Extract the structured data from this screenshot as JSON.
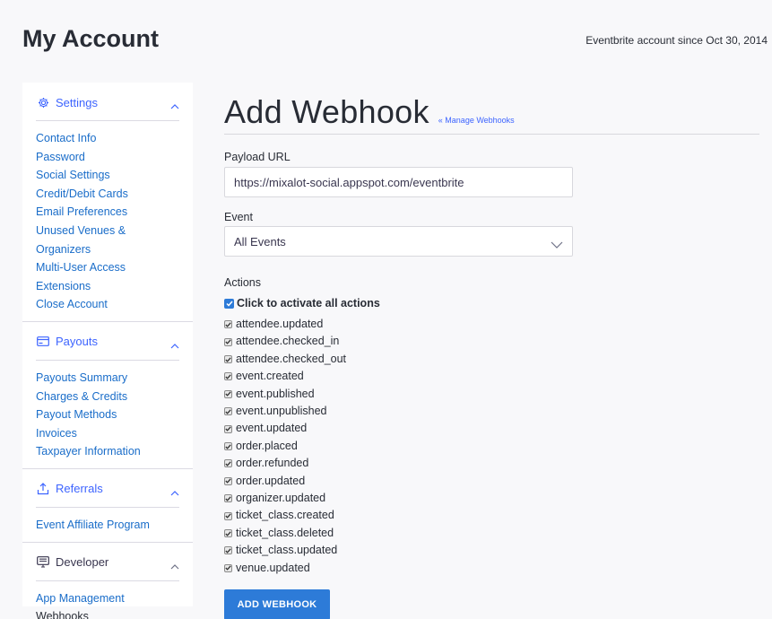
{
  "header": {
    "title": "My Account",
    "account_since": "Eventbrite account since Oct 30, 2014"
  },
  "sidebar": {
    "sections": [
      {
        "label": "Settings",
        "icon": "gear-icon",
        "items": [
          "Contact Info",
          "Password",
          "Social Settings",
          "Credit/Debit Cards",
          "Email Preferences",
          "Unused Venues & Organizers",
          "Multi-User Access",
          "Extensions",
          "Close Account"
        ]
      },
      {
        "label": "Payouts",
        "icon": "card-icon",
        "items": [
          "Payouts Summary",
          "Charges & Credits",
          "Payout Methods",
          "Invoices",
          "Taxpayer Information"
        ]
      },
      {
        "label": "Referrals",
        "icon": "share-icon",
        "items": [
          "Event Affiliate Program"
        ]
      },
      {
        "label": "Developer",
        "icon": "monitor-icon",
        "items": [
          "App Management",
          "Webhooks"
        ]
      }
    ]
  },
  "main": {
    "title": "Add Webhook",
    "manage_link": "« Manage Webhooks",
    "payload_label": "Payload URL",
    "payload_value": "https://mixalot-social.appspot.com/eventbrite",
    "event_label": "Event",
    "event_value": "All Events",
    "actions_label": "Actions",
    "activate_all": "Click to activate all actions",
    "actions": [
      "attendee.updated",
      "attendee.checked_in",
      "attendee.checked_out",
      "event.created",
      "event.published",
      "event.unpublished",
      "event.updated",
      "order.placed",
      "order.refunded",
      "order.updated",
      "organizer.updated",
      "ticket_class.created",
      "ticket_class.deleted",
      "ticket_class.updated",
      "venue.updated"
    ],
    "submit_label": "ADD WEBHOOK"
  },
  "colors": {
    "link_blue": "#1a6dc9",
    "accent_blue": "#3d64ff",
    "button_blue": "#2d7bd8"
  }
}
